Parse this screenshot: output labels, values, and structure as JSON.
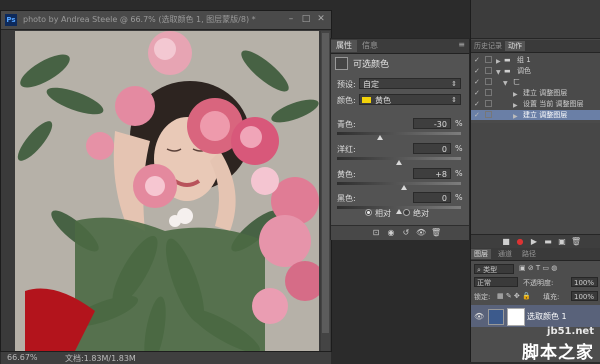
{
  "document": {
    "app_badge": "Ps",
    "title": "photo by Andrea Steele @ 66.7% (选取颜色 1, 图层蒙版/8) *",
    "zoom": "66.67%",
    "doc_info": "文档:1.83M/1.83M"
  },
  "properties": {
    "tabs": [
      "属性",
      "信息"
    ],
    "title": "可选颜色",
    "preset_label": "预设:",
    "preset_value": "自定",
    "colors_label": "颜色:",
    "colors_value": "黄色",
    "colors_swatch": "#f2d20a",
    "sliders": [
      {
        "label": "青色:",
        "value": "-30",
        "unit": "%",
        "level": -30
      },
      {
        "label": "洋红:",
        "value": "0",
        "unit": "%",
        "level": 0
      },
      {
        "label": "黄色:",
        "value": "+8",
        "unit": "%",
        "level": 8
      },
      {
        "label": "黑色:",
        "value": "0",
        "unit": "%",
        "level": 0
      }
    ],
    "method": [
      {
        "label": "相对",
        "selected": true
      },
      {
        "label": "绝对",
        "selected": false
      }
    ]
  },
  "history": {
    "tabs": [
      "历史记录",
      "动作"
    ],
    "items": [
      {
        "label": "组 1"
      },
      {
        "label": "调色"
      },
      {
        "label": "ㄈ"
      },
      {
        "label": "建立 调整图层"
      },
      {
        "label": "设置 当前 调整图层"
      },
      {
        "label": "建立 调整图层"
      }
    ]
  },
  "layers": {
    "tabs": [
      "图层",
      "通道",
      "路径"
    ],
    "filter_label": "类型",
    "blend_mode": "正常",
    "opacity_label": "不透明度:",
    "opacity_value": "100%",
    "lock_label": "锁定:",
    "fill_label": "填充:",
    "fill_value": "100%",
    "top_layer_name": "选取颜色 1"
  },
  "watermark": {
    "url": "jb51.net",
    "name": "脚本之家"
  },
  "colors": {
    "accent_selection": "#6a7fa6",
    "panel_bg": "#535353",
    "dock_bg": "#474747"
  }
}
